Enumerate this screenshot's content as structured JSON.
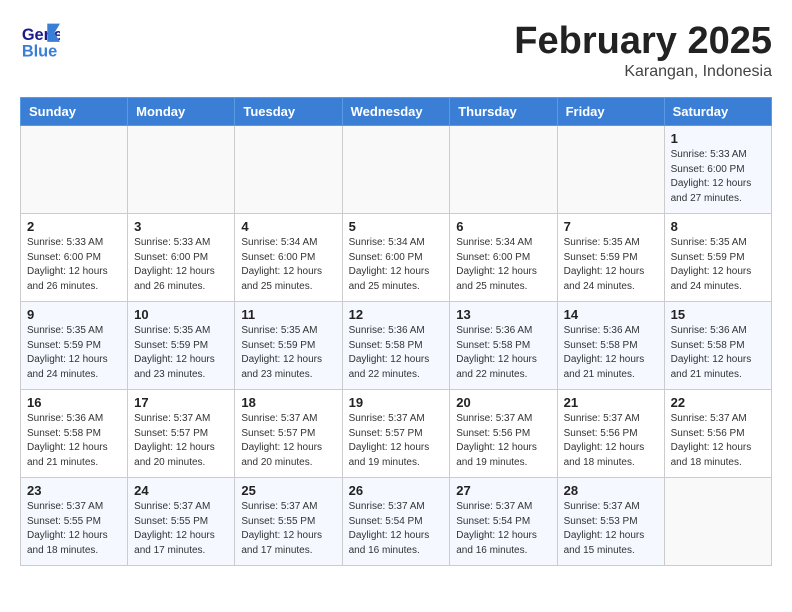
{
  "logo": {
    "line1": "General",
    "line2": "Blue"
  },
  "title": "February 2025",
  "location": "Karangan, Indonesia",
  "days_of_week": [
    "Sunday",
    "Monday",
    "Tuesday",
    "Wednesday",
    "Thursday",
    "Friday",
    "Saturday"
  ],
  "weeks": [
    [
      {
        "day": "",
        "info": ""
      },
      {
        "day": "",
        "info": ""
      },
      {
        "day": "",
        "info": ""
      },
      {
        "day": "",
        "info": ""
      },
      {
        "day": "",
        "info": ""
      },
      {
        "day": "",
        "info": ""
      },
      {
        "day": "1",
        "info": "Sunrise: 5:33 AM\nSunset: 6:00 PM\nDaylight: 12 hours\nand 27 minutes."
      }
    ],
    [
      {
        "day": "2",
        "info": "Sunrise: 5:33 AM\nSunset: 6:00 PM\nDaylight: 12 hours\nand 26 minutes."
      },
      {
        "day": "3",
        "info": "Sunrise: 5:33 AM\nSunset: 6:00 PM\nDaylight: 12 hours\nand 26 minutes."
      },
      {
        "day": "4",
        "info": "Sunrise: 5:34 AM\nSunset: 6:00 PM\nDaylight: 12 hours\nand 25 minutes."
      },
      {
        "day": "5",
        "info": "Sunrise: 5:34 AM\nSunset: 6:00 PM\nDaylight: 12 hours\nand 25 minutes."
      },
      {
        "day": "6",
        "info": "Sunrise: 5:34 AM\nSunset: 6:00 PM\nDaylight: 12 hours\nand 25 minutes."
      },
      {
        "day": "7",
        "info": "Sunrise: 5:35 AM\nSunset: 5:59 PM\nDaylight: 12 hours\nand 24 minutes."
      },
      {
        "day": "8",
        "info": "Sunrise: 5:35 AM\nSunset: 5:59 PM\nDaylight: 12 hours\nand 24 minutes."
      }
    ],
    [
      {
        "day": "9",
        "info": "Sunrise: 5:35 AM\nSunset: 5:59 PM\nDaylight: 12 hours\nand 24 minutes."
      },
      {
        "day": "10",
        "info": "Sunrise: 5:35 AM\nSunset: 5:59 PM\nDaylight: 12 hours\nand 23 minutes."
      },
      {
        "day": "11",
        "info": "Sunrise: 5:35 AM\nSunset: 5:59 PM\nDaylight: 12 hours\nand 23 minutes."
      },
      {
        "day": "12",
        "info": "Sunrise: 5:36 AM\nSunset: 5:58 PM\nDaylight: 12 hours\nand 22 minutes."
      },
      {
        "day": "13",
        "info": "Sunrise: 5:36 AM\nSunset: 5:58 PM\nDaylight: 12 hours\nand 22 minutes."
      },
      {
        "day": "14",
        "info": "Sunrise: 5:36 AM\nSunset: 5:58 PM\nDaylight: 12 hours\nand 21 minutes."
      },
      {
        "day": "15",
        "info": "Sunrise: 5:36 AM\nSunset: 5:58 PM\nDaylight: 12 hours\nand 21 minutes."
      }
    ],
    [
      {
        "day": "16",
        "info": "Sunrise: 5:36 AM\nSunset: 5:58 PM\nDaylight: 12 hours\nand 21 minutes."
      },
      {
        "day": "17",
        "info": "Sunrise: 5:37 AM\nSunset: 5:57 PM\nDaylight: 12 hours\nand 20 minutes."
      },
      {
        "day": "18",
        "info": "Sunrise: 5:37 AM\nSunset: 5:57 PM\nDaylight: 12 hours\nand 20 minutes."
      },
      {
        "day": "19",
        "info": "Sunrise: 5:37 AM\nSunset: 5:57 PM\nDaylight: 12 hours\nand 19 minutes."
      },
      {
        "day": "20",
        "info": "Sunrise: 5:37 AM\nSunset: 5:56 PM\nDaylight: 12 hours\nand 19 minutes."
      },
      {
        "day": "21",
        "info": "Sunrise: 5:37 AM\nSunset: 5:56 PM\nDaylight: 12 hours\nand 18 minutes."
      },
      {
        "day": "22",
        "info": "Sunrise: 5:37 AM\nSunset: 5:56 PM\nDaylight: 12 hours\nand 18 minutes."
      }
    ],
    [
      {
        "day": "23",
        "info": "Sunrise: 5:37 AM\nSunset: 5:55 PM\nDaylight: 12 hours\nand 18 minutes."
      },
      {
        "day": "24",
        "info": "Sunrise: 5:37 AM\nSunset: 5:55 PM\nDaylight: 12 hours\nand 17 minutes."
      },
      {
        "day": "25",
        "info": "Sunrise: 5:37 AM\nSunset: 5:55 PM\nDaylight: 12 hours\nand 17 minutes."
      },
      {
        "day": "26",
        "info": "Sunrise: 5:37 AM\nSunset: 5:54 PM\nDaylight: 12 hours\nand 16 minutes."
      },
      {
        "day": "27",
        "info": "Sunrise: 5:37 AM\nSunset: 5:54 PM\nDaylight: 12 hours\nand 16 minutes."
      },
      {
        "day": "28",
        "info": "Sunrise: 5:37 AM\nSunset: 5:53 PM\nDaylight: 12 hours\nand 15 minutes."
      },
      {
        "day": "",
        "info": ""
      }
    ]
  ]
}
